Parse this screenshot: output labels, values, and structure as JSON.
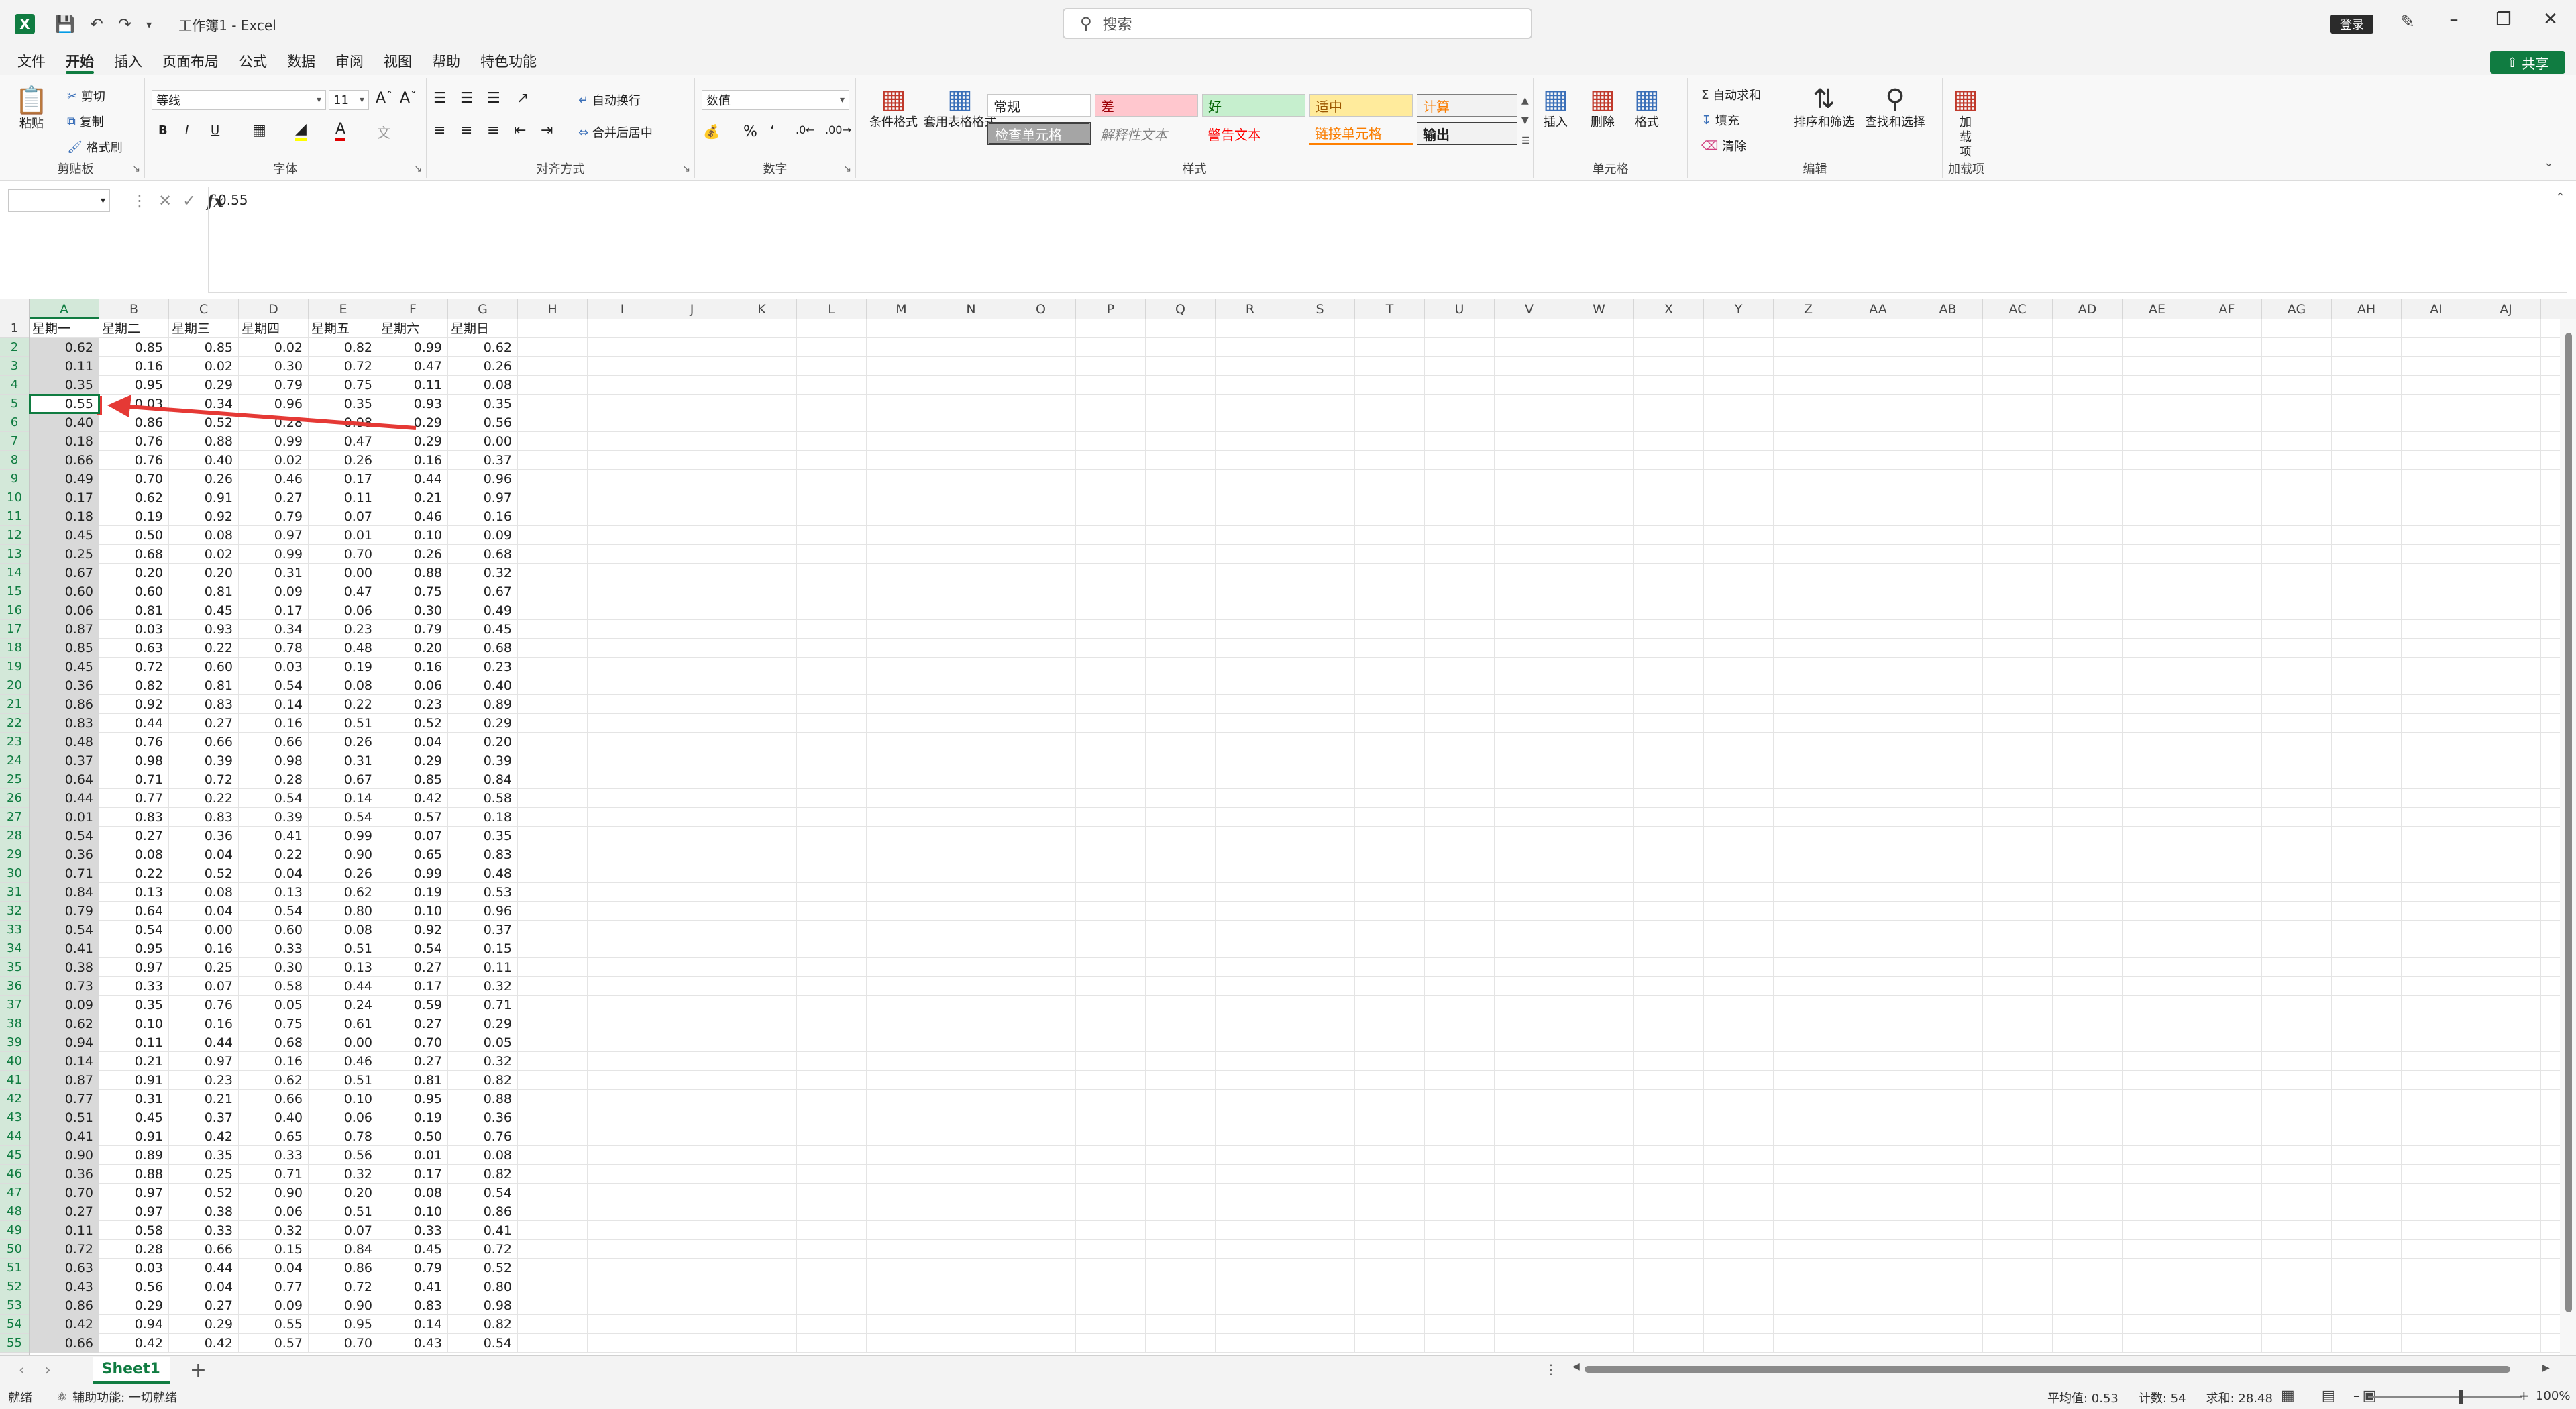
{
  "titlebar": {
    "doc_title": "工作簿1 - Excel",
    "search_placeholder": "搜索",
    "login_label": "登录"
  },
  "menu": {
    "tabs": [
      "文件",
      "开始",
      "插入",
      "页面布局",
      "公式",
      "数据",
      "审阅",
      "视图",
      "帮助",
      "特色功能"
    ],
    "active": "开始",
    "share_label": "共享"
  },
  "ribbon": {
    "clipboard": {
      "label": "剪贴板",
      "paste": "粘贴",
      "cut": "剪切",
      "copy": "复制",
      "format_painter": "格式刷"
    },
    "font": {
      "label": "字体",
      "font_name": "等线",
      "font_size": "11"
    },
    "alignment": {
      "label": "对齐方式",
      "wrap": "自动换行",
      "merge": "合并后居中"
    },
    "number": {
      "label": "数字",
      "format": "数值"
    },
    "styles": {
      "label": "样式",
      "cond_format": "条件格式",
      "table_format": "套用表格格式",
      "cells": [
        "常规",
        "差",
        "好",
        "适中",
        "计算",
        "检查单元格",
        "解释性文本",
        "警告文本",
        "链接单元格",
        "输出"
      ]
    },
    "cells_group": {
      "label": "单元格",
      "insert": "插入",
      "delete": "删除",
      "format": "格式"
    },
    "editing": {
      "label": "编辑",
      "autosum": "自动求和",
      "fill": "填充",
      "clear": "清除",
      "sort_filter": "排序和筛选",
      "find_select": "查找和选择"
    },
    "addins": {
      "label": "加载项",
      "addins_btn": "加载项"
    }
  },
  "formula": {
    "name_box": "",
    "value": "0.55"
  },
  "grid": {
    "columns": [
      "A",
      "B",
      "C",
      "D",
      "E",
      "F",
      "G",
      "H",
      "I",
      "J",
      "K",
      "L",
      "M",
      "N",
      "O",
      "P",
      "Q",
      "R",
      "S",
      "T",
      "U",
      "V",
      "W",
      "X",
      "Y",
      "Z",
      "AA",
      "AB",
      "AC",
      "AD",
      "AE",
      "AF",
      "AG",
      "AH",
      "AI",
      "AJ"
    ],
    "headers": [
      "星期一",
      "星期二",
      "星期三",
      "星期四",
      "星期五",
      "星期六",
      "星期日"
    ],
    "rows": [
      [
        "0.62",
        "0.85",
        "0.85",
        "0.02",
        "0.82",
        "0.99",
        "0.62"
      ],
      [
        "0.11",
        "0.16",
        "0.02",
        "0.30",
        "0.72",
        "0.47",
        "0.26"
      ],
      [
        "0.35",
        "0.95",
        "0.29",
        "0.79",
        "0.75",
        "0.11",
        "0.08"
      ],
      [
        "0.55",
        "0.03",
        "0.34",
        "0.96",
        "0.35",
        "0.93",
        "0.35"
      ],
      [
        "0.40",
        "0.86",
        "0.52",
        "0.28",
        "0.98",
        "0.29",
        "0.56"
      ],
      [
        "0.18",
        "0.76",
        "0.88",
        "0.99",
        "0.47",
        "0.29",
        "0.00"
      ],
      [
        "0.66",
        "0.76",
        "0.40",
        "0.02",
        "0.26",
        "0.16",
        "0.37"
      ],
      [
        "0.49",
        "0.70",
        "0.26",
        "0.46",
        "0.17",
        "0.44",
        "0.96"
      ],
      [
        "0.17",
        "0.62",
        "0.91",
        "0.27",
        "0.11",
        "0.21",
        "0.97"
      ],
      [
        "0.18",
        "0.19",
        "0.92",
        "0.79",
        "0.07",
        "0.46",
        "0.16"
      ],
      [
        "0.45",
        "0.50",
        "0.08",
        "0.97",
        "0.01",
        "0.10",
        "0.09"
      ],
      [
        "0.25",
        "0.68",
        "0.02",
        "0.99",
        "0.70",
        "0.26",
        "0.68"
      ],
      [
        "0.67",
        "0.20",
        "0.20",
        "0.31",
        "0.00",
        "0.88",
        "0.32"
      ],
      [
        "0.60",
        "0.60",
        "0.81",
        "0.09",
        "0.47",
        "0.75",
        "0.67"
      ],
      [
        "0.06",
        "0.81",
        "0.45",
        "0.17",
        "0.06",
        "0.30",
        "0.49"
      ],
      [
        "0.87",
        "0.03",
        "0.93",
        "0.34",
        "0.23",
        "0.79",
        "0.45"
      ],
      [
        "0.85",
        "0.63",
        "0.22",
        "0.78",
        "0.48",
        "0.20",
        "0.68"
      ],
      [
        "0.45",
        "0.72",
        "0.60",
        "0.03",
        "0.19",
        "0.16",
        "0.23"
      ],
      [
        "0.36",
        "0.82",
        "0.81",
        "0.54",
        "0.08",
        "0.06",
        "0.40"
      ],
      [
        "0.86",
        "0.92",
        "0.83",
        "0.14",
        "0.22",
        "0.23",
        "0.89"
      ],
      [
        "0.83",
        "0.44",
        "0.27",
        "0.16",
        "0.51",
        "0.52",
        "0.29"
      ],
      [
        "0.48",
        "0.76",
        "0.66",
        "0.66",
        "0.26",
        "0.04",
        "0.20"
      ],
      [
        "0.37",
        "0.98",
        "0.39",
        "0.98",
        "0.31",
        "0.29",
        "0.39"
      ],
      [
        "0.64",
        "0.71",
        "0.72",
        "0.28",
        "0.67",
        "0.85",
        "0.84"
      ],
      [
        "0.44",
        "0.77",
        "0.22",
        "0.54",
        "0.14",
        "0.42",
        "0.58"
      ],
      [
        "0.01",
        "0.83",
        "0.83",
        "0.39",
        "0.54",
        "0.57",
        "0.18"
      ],
      [
        "0.54",
        "0.27",
        "0.36",
        "0.41",
        "0.99",
        "0.07",
        "0.35"
      ],
      [
        "0.36",
        "0.08",
        "0.04",
        "0.22",
        "0.90",
        "0.65",
        "0.83"
      ],
      [
        "0.71",
        "0.22",
        "0.52",
        "0.04",
        "0.26",
        "0.99",
        "0.48"
      ],
      [
        "0.84",
        "0.13",
        "0.08",
        "0.13",
        "0.62",
        "0.19",
        "0.53"
      ],
      [
        "0.79",
        "0.64",
        "0.04",
        "0.54",
        "0.80",
        "0.10",
        "0.96"
      ],
      [
        "0.54",
        "0.54",
        "0.00",
        "0.60",
        "0.08",
        "0.92",
        "0.37"
      ],
      [
        "0.41",
        "0.95",
        "0.16",
        "0.33",
        "0.51",
        "0.54",
        "0.15"
      ],
      [
        "0.38",
        "0.97",
        "0.25",
        "0.30",
        "0.13",
        "0.27",
        "0.11"
      ],
      [
        "0.73",
        "0.33",
        "0.07",
        "0.58",
        "0.44",
        "0.17",
        "0.32"
      ],
      [
        "0.09",
        "0.35",
        "0.76",
        "0.05",
        "0.24",
        "0.59",
        "0.71"
      ],
      [
        "0.62",
        "0.10",
        "0.16",
        "0.75",
        "0.61",
        "0.27",
        "0.29"
      ],
      [
        "0.94",
        "0.11",
        "0.44",
        "0.68",
        "0.00",
        "0.70",
        "0.05"
      ],
      [
        "0.14",
        "0.21",
        "0.97",
        "0.16",
        "0.46",
        "0.27",
        "0.32"
      ],
      [
        "0.87",
        "0.91",
        "0.23",
        "0.62",
        "0.51",
        "0.81",
        "0.82"
      ],
      [
        "0.77",
        "0.31",
        "0.21",
        "0.66",
        "0.10",
        "0.95",
        "0.88"
      ],
      [
        "0.51",
        "0.45",
        "0.37",
        "0.40",
        "0.06",
        "0.19",
        "0.36"
      ],
      [
        "0.41",
        "0.91",
        "0.42",
        "0.65",
        "0.78",
        "0.50",
        "0.76"
      ],
      [
        "0.90",
        "0.89",
        "0.35",
        "0.33",
        "0.56",
        "0.01",
        "0.08"
      ],
      [
        "0.36",
        "0.88",
        "0.25",
        "0.71",
        "0.32",
        "0.17",
        "0.82"
      ],
      [
        "0.70",
        "0.97",
        "0.52",
        "0.90",
        "0.20",
        "0.08",
        "0.54"
      ],
      [
        "0.27",
        "0.97",
        "0.38",
        "0.06",
        "0.51",
        "0.10",
        "0.86"
      ],
      [
        "0.11",
        "0.58",
        "0.33",
        "0.32",
        "0.07",
        "0.33",
        "0.41"
      ],
      [
        "0.72",
        "0.28",
        "0.66",
        "0.15",
        "0.84",
        "0.45",
        "0.72"
      ],
      [
        "0.63",
        "0.03",
        "0.44",
        "0.04",
        "0.86",
        "0.79",
        "0.52"
      ],
      [
        "0.43",
        "0.56",
        "0.04",
        "0.77",
        "0.72",
        "0.41",
        "0.80"
      ],
      [
        "0.86",
        "0.29",
        "0.27",
        "0.09",
        "0.90",
        "0.83",
        "0.98"
      ],
      [
        "0.42",
        "0.94",
        "0.29",
        "0.55",
        "0.95",
        "0.14",
        "0.82"
      ],
      [
        "0.66",
        "0.42",
        "0.42",
        "0.57",
        "0.70",
        "0.43",
        "0.54"
      ]
    ]
  },
  "sheets": {
    "tabs": [
      "Sheet1"
    ]
  },
  "status": {
    "ready": "就绪",
    "accessibility": "辅助功能: 一切就绪",
    "average": "平均值: 0.53",
    "count": "计数: 54",
    "sum": "求和: 28.48",
    "zoom": "100%"
  },
  "colors": {
    "accent": "#107c41",
    "annotation": "#e53935",
    "bad_bg": "#ffc7ce",
    "good_bg": "#c6efce",
    "neutral_bg": "#ffeb9c"
  }
}
